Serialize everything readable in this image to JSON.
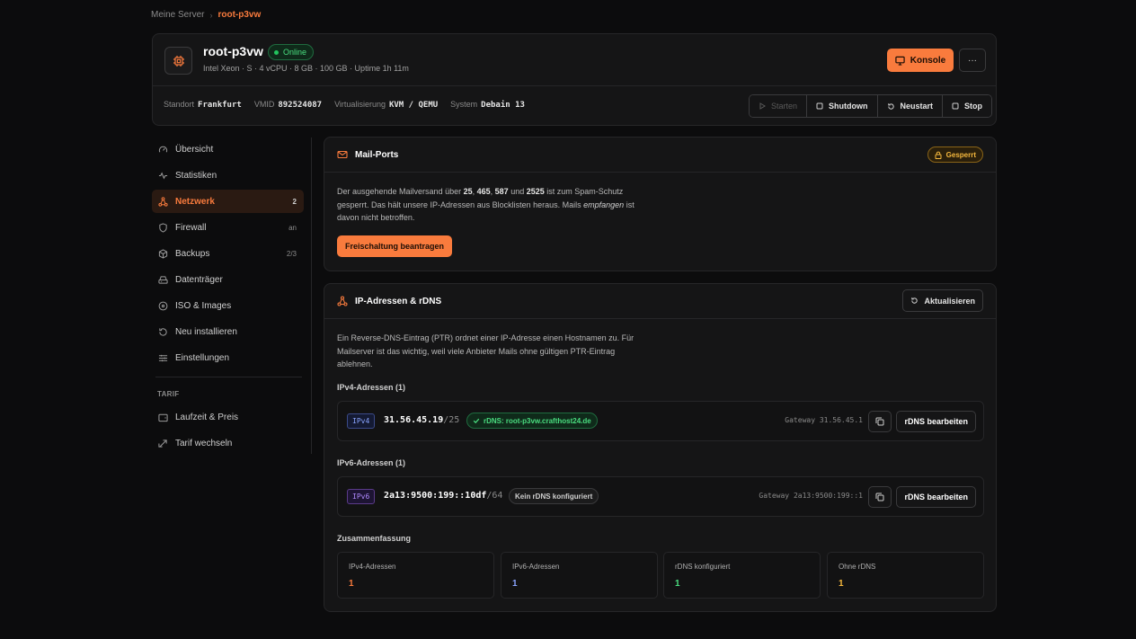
{
  "breadcrumb": {
    "parent": "Meine Server",
    "separator": "›",
    "current": "root-p3vw"
  },
  "server": {
    "name": "root-p3vw",
    "status": "Online",
    "specs": "Intel Xeon · S  ·  4 vCPU  ·  8 GB  ·  100 GB  ·  Uptime 1h 11m",
    "console_label": "Konsole",
    "more_label": "···"
  },
  "meta": [
    {
      "label": "Standort",
      "value": "Frankfurt"
    },
    {
      "label": "VMID",
      "value": "892524087"
    },
    {
      "label": "Virtualisierung",
      "value": "KVM / QEMU"
    },
    {
      "label": "System",
      "value": "Debain 13"
    }
  ],
  "power": {
    "start": "Starten",
    "shutdown": "Shutdown",
    "restart": "Neustart",
    "stop": "Stop"
  },
  "sidebar": {
    "items": [
      {
        "label": "Übersicht",
        "count": "",
        "icon": "gauge-icon"
      },
      {
        "label": "Statistiken",
        "count": "",
        "icon": "activity-icon"
      },
      {
        "label": "Netzwerk",
        "count": "2",
        "icon": "network-icon"
      },
      {
        "label": "Firewall",
        "count": "an",
        "icon": "shield-icon"
      },
      {
        "label": "Backups",
        "count": "2/3",
        "icon": "box-icon"
      },
      {
        "label": "Datenträger",
        "count": "",
        "icon": "hard-drive-icon"
      },
      {
        "label": "ISO & Images",
        "count": "",
        "icon": "disc-icon"
      },
      {
        "label": "Neu installieren",
        "count": "",
        "icon": "rotate-icon"
      },
      {
        "label": "Einstellungen",
        "count": "",
        "icon": "sliders-icon"
      }
    ],
    "section": "TARIF",
    "tarif_items": [
      {
        "label": "Laufzeit & Preis",
        "icon": "wallet-icon"
      },
      {
        "label": "Tarif wechseln",
        "icon": "swap-icon"
      }
    ]
  },
  "mail": {
    "title": "Mail-Ports",
    "badge": "Gesperrt",
    "text_1": "Der ausgehende Mailversand über ",
    "port_1": "25",
    "port_2": "465",
    "port_3": "587",
    "text_and": " und ",
    "port_4": "2525",
    "text_2": " ist zum Spam-Schutz gesperrt. Das hält unsere IP-Adressen aus Blocklisten heraus. Mails ",
    "emph": "empfangen",
    "text_3": " ist davon nicht betroffen.",
    "button": "Freischaltung beantragen"
  },
  "ip": {
    "title": "IP-Adressen & rDNS",
    "refresh": "Aktualisieren",
    "description": "Ein Reverse-DNS-Eintrag (PTR) ordnet einer IP-Adresse einen Hostnamen zu. Für Mailserver ist das wichtig, weil viele Anbieter Mails ohne gültigen PTR-Eintrag ablehnen.",
    "v4_heading": "IPv4-Adressen (1)",
    "v6_heading": "IPv6-Adressen (1)",
    "v4": {
      "tag": "IPv4",
      "address": "31.56.45.19",
      "cidr": "/25",
      "rdns": "rDNS: root-p3vw.crafthost24.de",
      "gateway": "Gateway 31.56.45.1",
      "edit": "rDNS bearbeiten"
    },
    "v6": {
      "tag": "IPv6",
      "address": "2a13:9500:199::10df",
      "cidr": "/64",
      "rdns": "Kein rDNS konfiguriert",
      "gateway": "Gateway 2a13:9500:199::1",
      "edit": "rDNS bearbeiten"
    },
    "summary_heading": "Zusammenfassung",
    "summary": [
      {
        "label": "IPv4-Adressen",
        "value": "1",
        "color": "#f97b3d"
      },
      {
        "label": "IPv6-Adressen",
        "value": "1",
        "color": "#8aa4ff"
      },
      {
        "label": "rDNS konfiguriert",
        "value": "1",
        "color": "#4ade80"
      },
      {
        "label": "Ohne rDNS",
        "value": "1",
        "color": "#f5b83d"
      }
    ]
  },
  "colors": {
    "accent": "#f97b3d",
    "success": "#4ade80",
    "warning": "#f5b83d",
    "background": "#0c0c0d"
  }
}
